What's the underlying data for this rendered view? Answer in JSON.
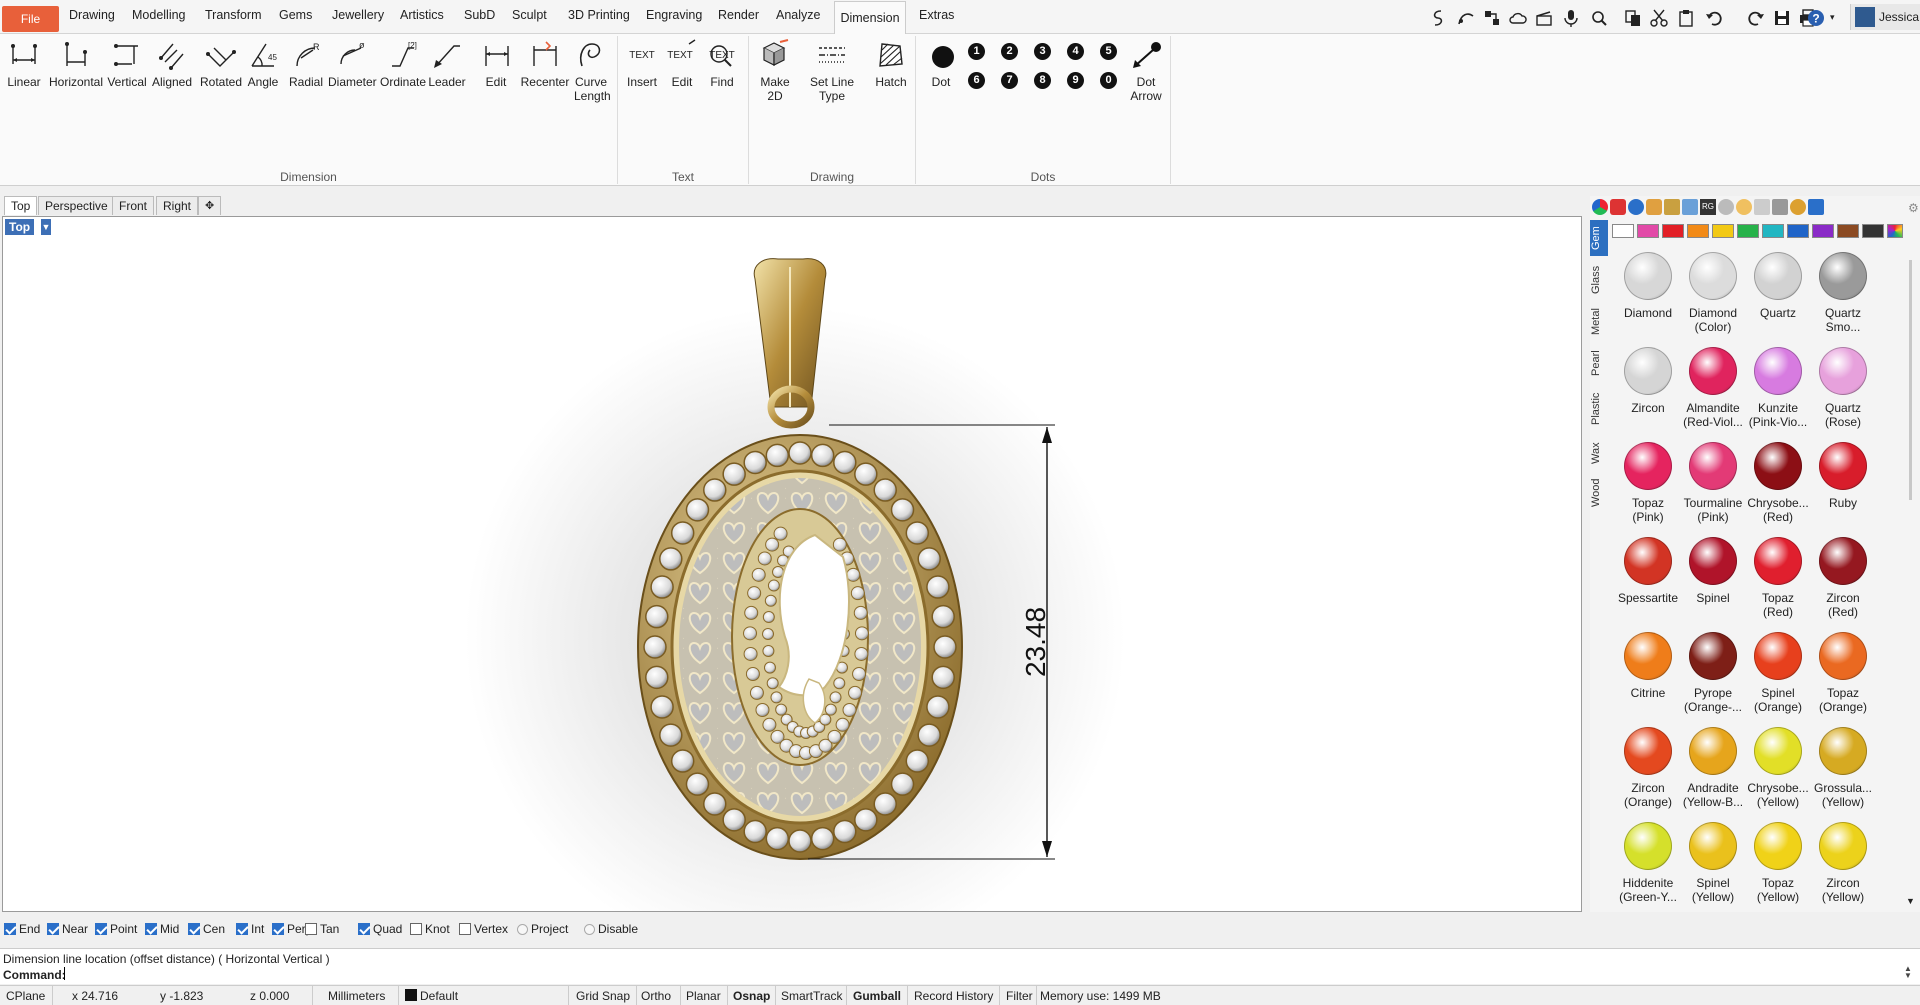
{
  "menu": {
    "file": "File",
    "tabs": [
      "Drawing",
      "Modelling",
      "Transform",
      "Gems",
      "Jewellery",
      "Artistics",
      "SubD",
      "Sculpt",
      "3D Printing",
      "Engraving",
      "Render",
      "Analyze"
    ],
    "active": "Dimension",
    "extras": "Extras",
    "user": "Jessica"
  },
  "ribbon": {
    "dimension_tools": [
      "Linear",
      "Horizontal",
      "Vertical",
      "Aligned",
      "Rotated",
      "Angle",
      "Radial",
      "Diameter",
      "Ordinate",
      "Leader",
      "Edit",
      "Recenter"
    ],
    "curve_length": [
      "Curve",
      "Length"
    ],
    "text_tools": [
      "Insert",
      "Edit",
      "Find"
    ],
    "drawing_tools": {
      "make2d_1": "Make",
      "make2d_2": "2D",
      "set_line_type": "Set Line Type",
      "hatch": "Hatch"
    },
    "dots": {
      "dot": "Dot",
      "row1": [
        "1",
        "2",
        "3",
        "4",
        "5"
      ],
      "row2": [
        "6",
        "7",
        "8",
        "9",
        "0"
      ],
      "dot_arrow_1": "Dot",
      "dot_arrow_2": "Arrow"
    },
    "groups": {
      "dimension": "Dimension",
      "text": "Text",
      "drawing": "Drawing",
      "dots": "Dots"
    }
  },
  "viewport_tabs": [
    "Top",
    "Perspective",
    "Front",
    "Right"
  ],
  "viewport": {
    "label": "Top",
    "dimension_value": "23.48"
  },
  "osnap": {
    "checked": [
      "End",
      "Near",
      "Point",
      "Mid",
      "Cen",
      "Int",
      "Perp"
    ],
    "tan": "Tan",
    "quad": "Quad",
    "unchecked": [
      "Knot",
      "Vertex"
    ],
    "radio": [
      "Project",
      "Disable"
    ]
  },
  "command": {
    "prompt": "Dimension line location (offset distance) ( Horizontal  Vertical )",
    "label": "Command:"
  },
  "status": {
    "cplane": "CPlane",
    "x": "x 24.716",
    "y": "y -1.823",
    "z": "z 0.000",
    "units": "Millimeters",
    "layer": "Default",
    "toggles": [
      "Grid Snap",
      "Ortho",
      "Planar",
      "Osnap",
      "SmartTrack",
      "Gumball",
      "Record History",
      "Filter"
    ],
    "memory": "Memory use: 1499 MB"
  },
  "panel": {
    "tabs": [
      "Gem",
      "Glass",
      "Metal",
      "Pearl",
      "Plastic",
      "Wax",
      "Wood"
    ],
    "swatch_colors": [
      "#ffffff",
      "#e24aa8",
      "#e21f26",
      "#f28a16",
      "#f2c914",
      "#27b24a",
      "#21b6c2",
      "#1f64c8",
      "#8a2bc7",
      "#8b4a22",
      "#333333"
    ],
    "gems": [
      {
        "name": "Diamond",
        "line2": "",
        "color": "#d7d7d7"
      },
      {
        "name": "Diamond",
        "line2": "(Color)",
        "color": "#dcdcdc"
      },
      {
        "name": "Quartz",
        "line2": "",
        "color": "#d2d2d2"
      },
      {
        "name": "Quartz",
        "line2": "Smo...",
        "color": "#9a9a9a"
      },
      {
        "name": "Zircon",
        "line2": "",
        "color": "#d5d5d5"
      },
      {
        "name": "Almandite",
        "line2": "(Red-Viol...",
        "color": "#e0245e"
      },
      {
        "name": "Kunzite",
        "line2": "(Pink-Vio...",
        "color": "#d77be0"
      },
      {
        "name": "Quartz",
        "line2": "(Rose)",
        "color": "#e7a1dc"
      },
      {
        "name": "Topaz",
        "line2": "(Pink)",
        "color": "#e5245f"
      },
      {
        "name": "Tourmaline",
        "line2": "(Pink)",
        "color": "#e33a76"
      },
      {
        "name": "Chrysobe...",
        "line2": "(Red)",
        "color": "#8c0f15"
      },
      {
        "name": "Ruby",
        "line2": "",
        "color": "#d81d2b"
      },
      {
        "name": "Spessartite",
        "line2": "",
        "color": "#d23424"
      },
      {
        "name": "Spinel",
        "line2": "",
        "color": "#b0142a"
      },
      {
        "name": "Topaz (Red)",
        "line2": "",
        "color": "#e01f2e"
      },
      {
        "name": "Zircon",
        "line2": "(Red)",
        "color": "#951820"
      },
      {
        "name": "Citrine",
        "line2": "",
        "color": "#ef7d1a"
      },
      {
        "name": "Pyrope",
        "line2": "(Orange-...",
        "color": "#7e1f17"
      },
      {
        "name": "Spinel",
        "line2": "(Orange)",
        "color": "#e7401d"
      },
      {
        "name": "Topaz",
        "line2": "(Orange)",
        "color": "#ea6921"
      },
      {
        "name": "Zircon",
        "line2": "(Orange)",
        "color": "#e4491f"
      },
      {
        "name": "Andradite",
        "line2": "(Yellow-B...",
        "color": "#e6a51c"
      },
      {
        "name": "Chrysobe...",
        "line2": "(Yellow)",
        "color": "#e2df27"
      },
      {
        "name": "Grossula...",
        "line2": "(Yellow)",
        "color": "#d6aa22"
      },
      {
        "name": "Hiddenite",
        "line2": "(Green-Y...",
        "color": "#d5e02b"
      },
      {
        "name": "Spinel",
        "line2": "(Yellow)",
        "color": "#eac11c"
      },
      {
        "name": "Topaz",
        "line2": "(Yellow)",
        "color": "#f0d218"
      },
      {
        "name": "Zircon",
        "line2": "(Yellow)",
        "color": "#ecd21b"
      }
    ]
  }
}
